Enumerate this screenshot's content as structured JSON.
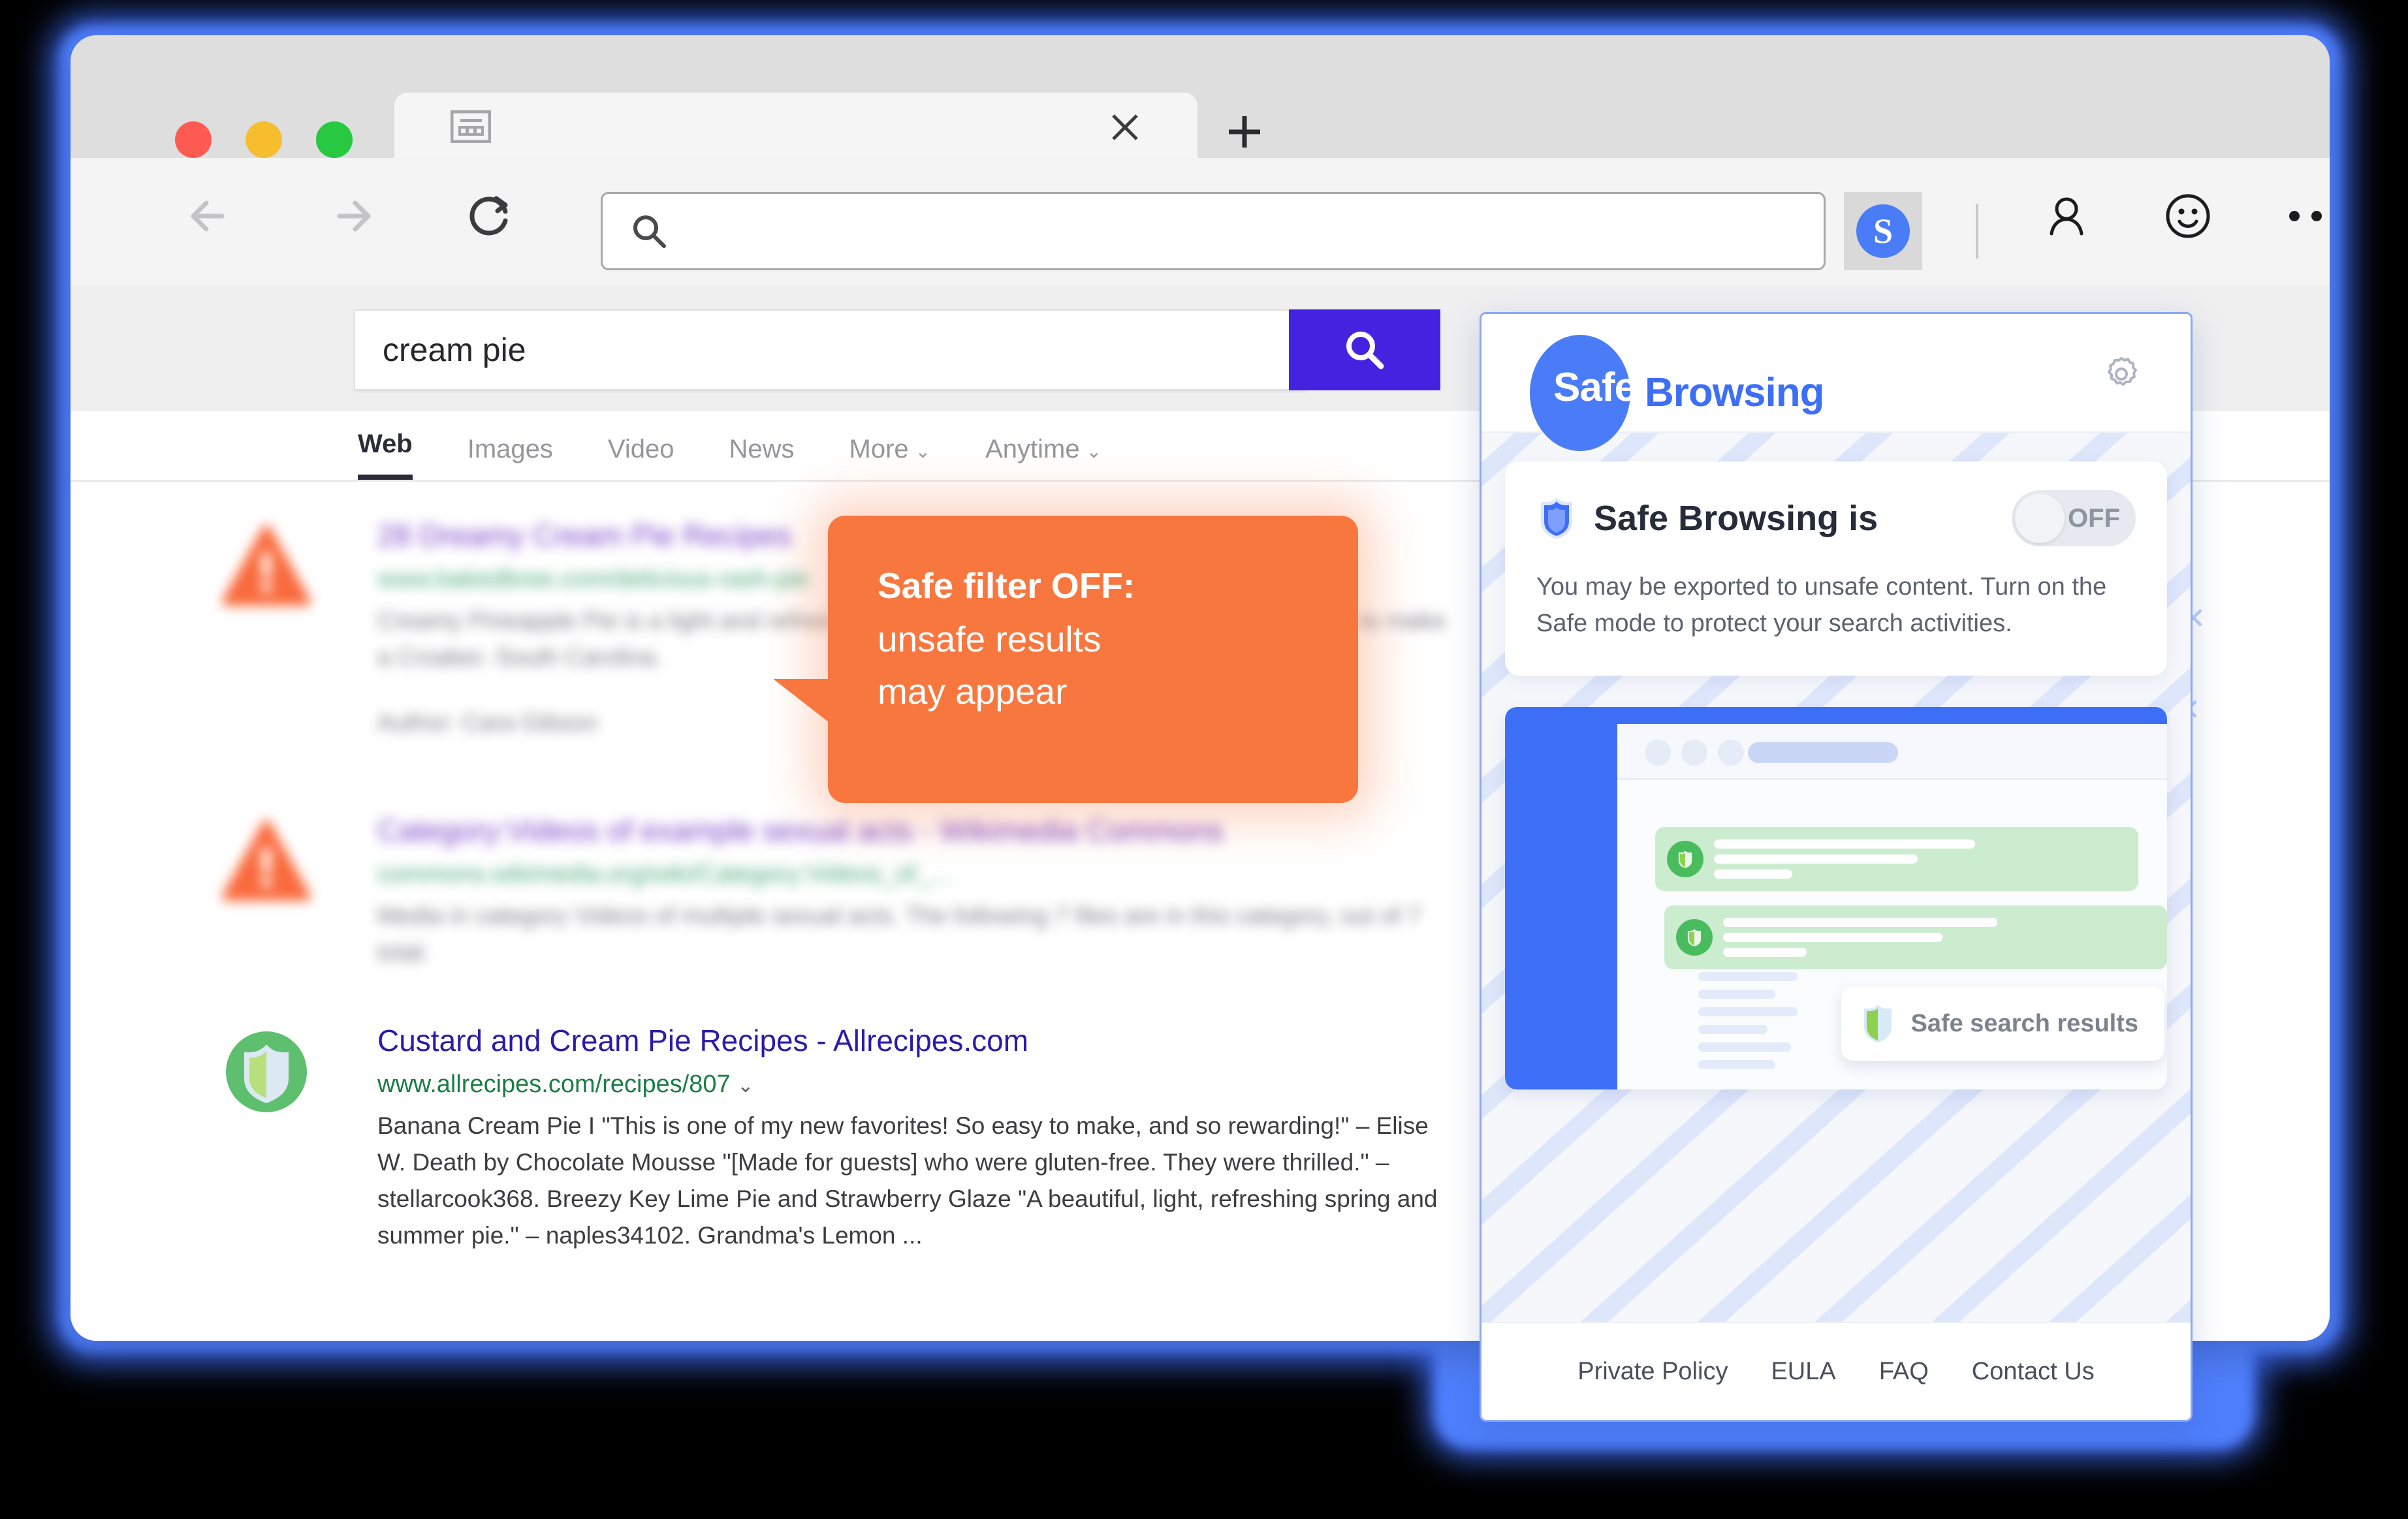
{
  "browser": {
    "window_controls": [
      "close",
      "minimize",
      "maximize"
    ],
    "tab": {
      "title": "",
      "favicon": "newtab-page-icon",
      "close_label": "×"
    },
    "new_tab_label": "+",
    "toolbar": {
      "back_icon": "back-arrow-icon",
      "forward_icon": "forward-arrow-icon",
      "reload_icon": "reload-icon",
      "address_placeholder": "",
      "address_value": "",
      "search_icon": "search-icon",
      "extension_badge": "S",
      "profile_icon": "person-icon",
      "smiley_icon": "smiley-icon",
      "more_icon": "more-menu-icon"
    }
  },
  "search": {
    "query": "cream pie",
    "submit_icon": "search-icon",
    "tabs": [
      {
        "label": "Web",
        "active": true,
        "has_caret": false
      },
      {
        "label": "Images",
        "active": false,
        "has_caret": false
      },
      {
        "label": "Video",
        "active": false,
        "has_caret": false
      },
      {
        "label": "News",
        "active": false,
        "has_caret": false
      },
      {
        "label": "More",
        "active": false,
        "has_caret": true
      },
      {
        "label": "Anytime",
        "active": false,
        "has_caret": true
      }
    ]
  },
  "results": [
    {
      "marker": "warning-triangle-icon",
      "blurred": true,
      "title": "28 Dreamy Cream Pie Recipes",
      "url": "www.bakedbree.com/delicious-rash-pie",
      "snippet": "Creamy Pineapple Pie is a light and refreshing summer pie. This is one of our favorite ways to make a Croaker. South Carolina.",
      "extra": "Author: Cara Gibson"
    },
    {
      "marker": "warning-triangle-icon",
      "blurred": true,
      "title": "Category:Videos of example sexual acts - Wikimedia Commons",
      "url": "commons.wikimedia.org/wiki/Category:Videos_of_...",
      "snippet": "Media in category Videos of multiple sexual acts. The following 7 files are in this category, out of 7 total.",
      "extra": ""
    },
    {
      "marker": "shield-safe-icon",
      "blurred": false,
      "title": "Custard and Cream Pie Recipes - Allrecipes.com",
      "url": "www.allrecipes.com/recipes/807",
      "url_caret": "⌄",
      "snippet": "Banana Cream Pie I \"This is one of my new favorites! So easy to make, and so rewarding!\" – Elise W. Death by Chocolate Mousse \"[Made for guests] who were gluten-free. They were thrilled.\" – stellarcook368. Breezy Key Lime Pie and Strawberry Glaze \"A beautiful, light, refreshing spring and summer pie.\" – naples34102. Grandma's Lemon ...",
      "extra": ""
    }
  ],
  "callout": {
    "line1": "Safe filter OFF:",
    "line2": "unsafe results\nmay appear",
    "bg_color": "#f8773f"
  },
  "panel": {
    "logo": {
      "badge_text": "Safe",
      "word": "Browsing",
      "accent": "#3d6ff6"
    },
    "settings_icon": "gear-icon",
    "card": {
      "shield_icon": "shield-blue-icon",
      "title": "Safe Browsing is",
      "toggle_state": "OFF",
      "toggle_on": false,
      "description": "You may be exported to unsafe content. Turn on the Safe mode to protect your search activities."
    },
    "illustration": {
      "chip_label": "Safe search results",
      "chip_icon": "shield-green-icon",
      "result_icon": "shield-green-circle-icon"
    },
    "footer_links": [
      "Private Policy",
      "EULA",
      "FAQ",
      "Contact Us"
    ]
  }
}
